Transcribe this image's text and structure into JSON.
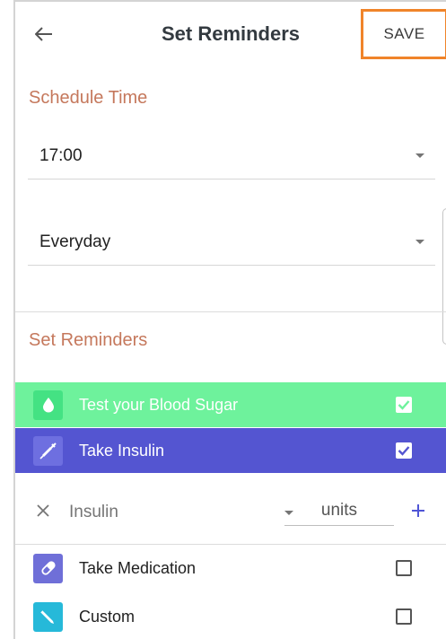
{
  "header": {
    "title": "Set Reminders",
    "save_label": "SAVE",
    "back_icon": "arrow-left-icon"
  },
  "schedule": {
    "title": "Schedule Time",
    "time_value": "17:00",
    "repeat_value": "Everyday"
  },
  "reminders": {
    "title": "Set Reminders",
    "items": [
      {
        "label": "Test your Blood Sugar",
        "icon": "drop-icon",
        "checked": true,
        "bg": "#6ef29c"
      },
      {
        "label": "Take Insulin",
        "icon": "syringe-icon",
        "checked": true,
        "bg": "#5455d1"
      },
      {
        "label": "Take Medication",
        "icon": "pill-icon",
        "checked": false,
        "bg": "#6f6fd8"
      },
      {
        "label": "Custom",
        "icon": "pencil-icon",
        "checked": false,
        "bg": "#26b9d9"
      }
    ],
    "insulin_row": {
      "type_value": "Insulin",
      "units_value": "units"
    }
  },
  "colors": {
    "accent_orange": "#f0842a",
    "section_title": "#c5785c",
    "plus_blue": "#4f55d6"
  }
}
